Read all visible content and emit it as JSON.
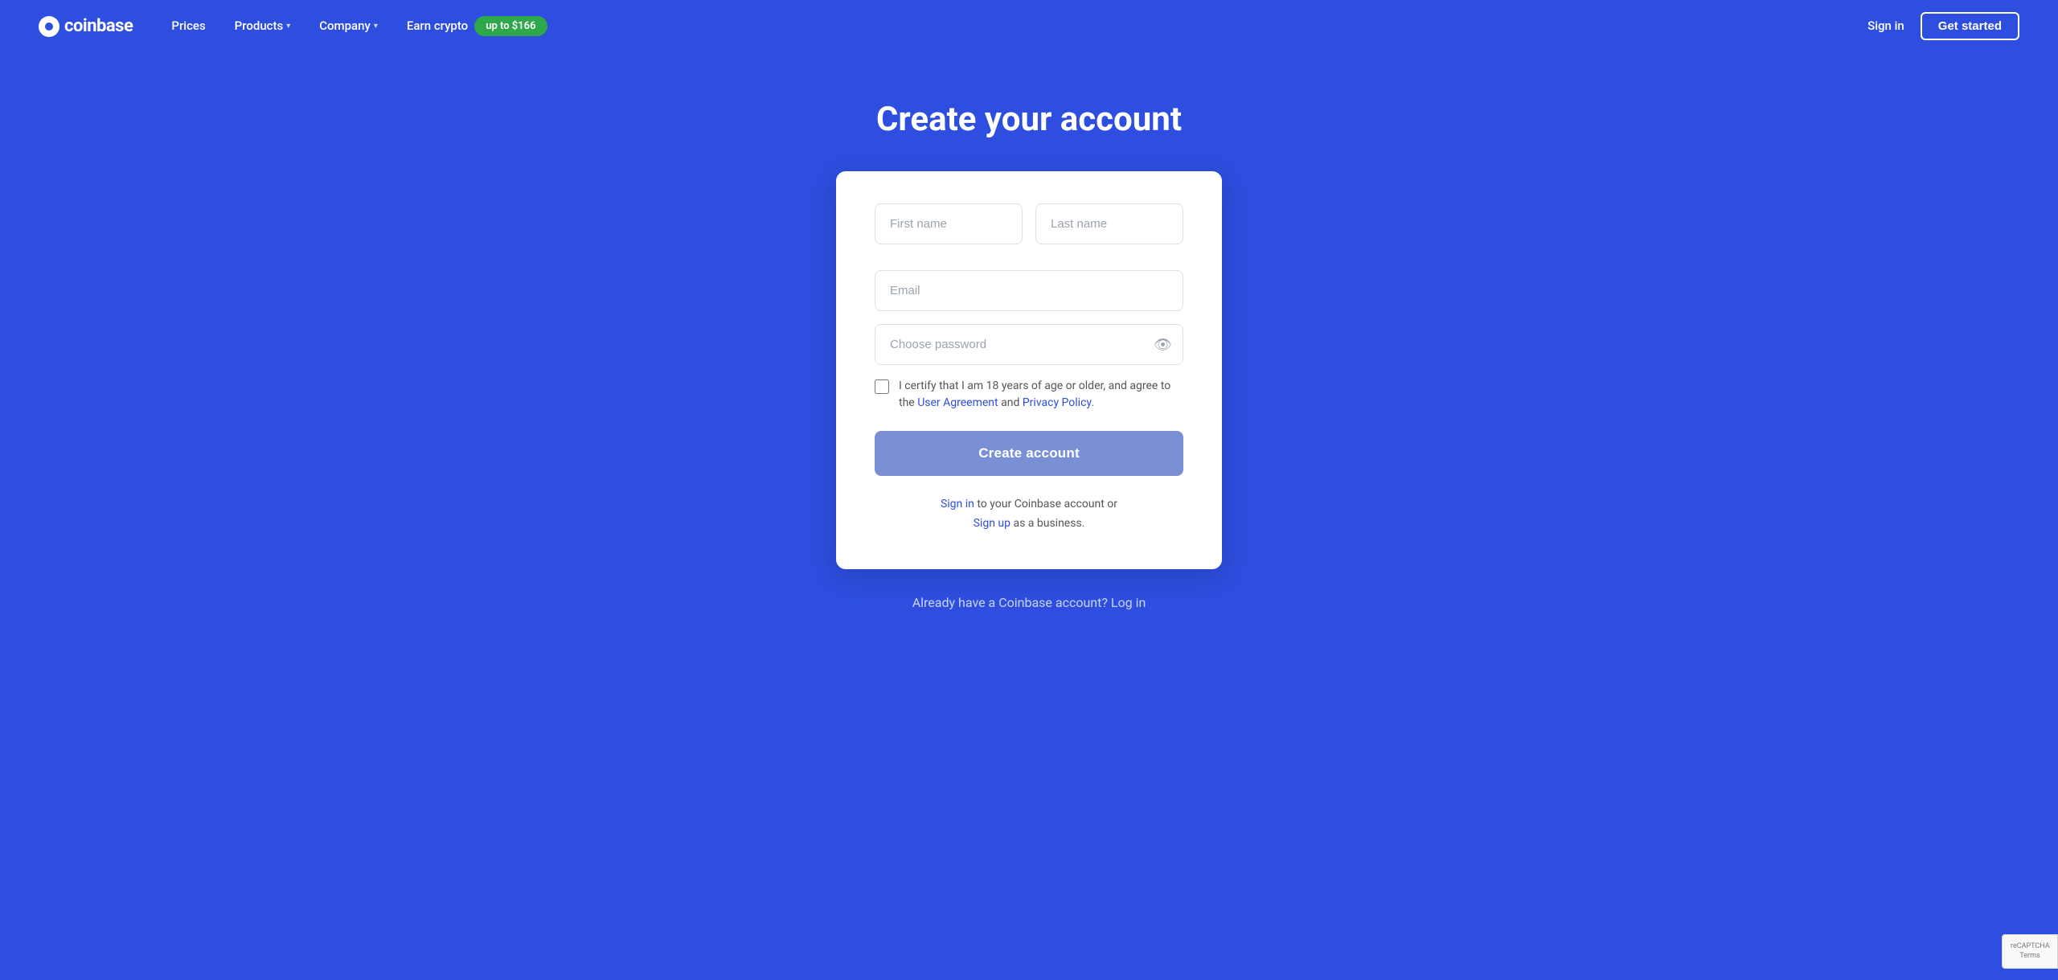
{
  "navbar": {
    "logo_text": "coinbase",
    "links": [
      {
        "label": "Prices",
        "has_dropdown": false
      },
      {
        "label": "Products",
        "has_dropdown": true
      },
      {
        "label": "Company",
        "has_dropdown": true
      }
    ],
    "earn_crypto_label": "Earn crypto",
    "earn_badge_label": "up to $166",
    "sign_in_label": "Sign in",
    "get_started_label": "Get started"
  },
  "page": {
    "title": "Create your account"
  },
  "form": {
    "first_name_placeholder": "First name",
    "last_name_placeholder": "Last name",
    "email_placeholder": "Email",
    "password_placeholder": "Choose password",
    "checkbox_text": "I certify that I am 18 years of age or older, and agree to the",
    "user_agreement_label": "User Agreement",
    "and_label": "and",
    "privacy_policy_label": "Privacy Policy",
    "period": ".",
    "create_account_label": "Create account",
    "footer_text1": "to your Coinbase account or",
    "footer_sign_in_label": "Sign in",
    "footer_sign_up_label": "Sign up",
    "footer_text2": "as a business."
  },
  "bottom": {
    "text": "Already have a Coinbase account? Log in"
  },
  "recaptcha": {
    "text": "reCAPTCHA\nTerms"
  },
  "colors": {
    "background": "#2d4ede",
    "card_bg": "#ffffff",
    "button_disabled": "#7b8fd4",
    "link_color": "#2d4ede",
    "earn_badge": "#2ea84b"
  }
}
